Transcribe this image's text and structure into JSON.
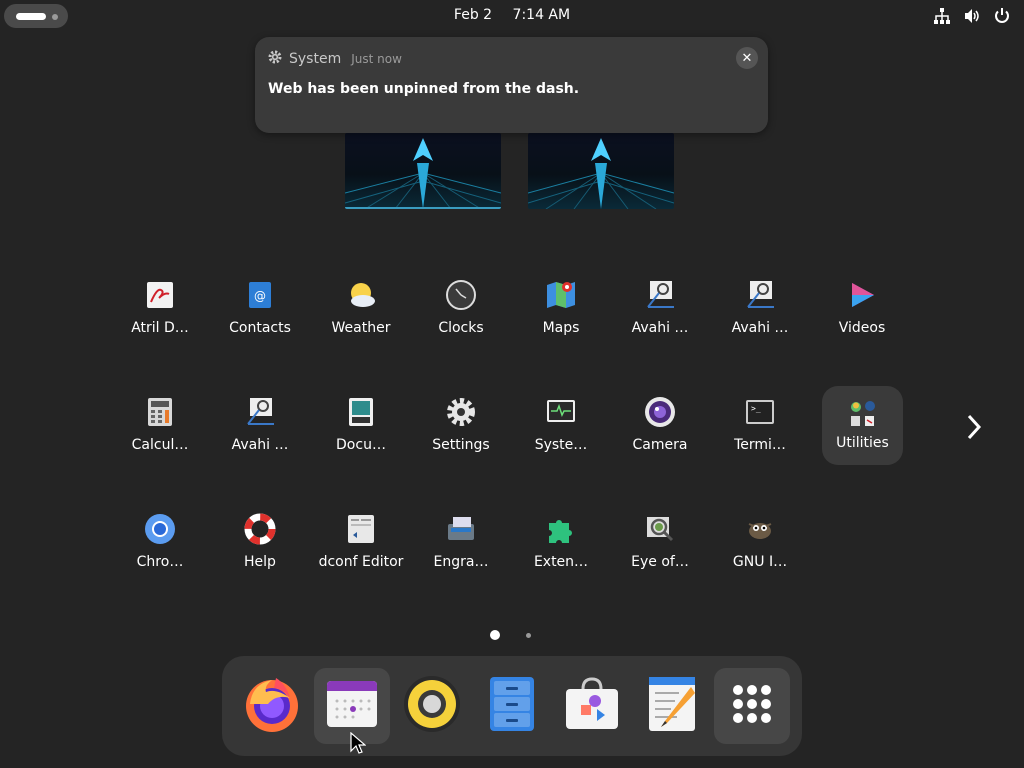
{
  "topbar": {
    "date": "Feb 2",
    "time": "7:14 AM",
    "icons": [
      "network-icon",
      "volume-icon",
      "power-icon"
    ]
  },
  "notification": {
    "source": "System",
    "time": "Just now",
    "message": "Web has been unpinned from the dash.",
    "close_icon": "close-icon"
  },
  "app_grid": {
    "rows": [
      [
        {
          "label": "Atril D…",
          "icon": "atril-icon"
        },
        {
          "label": "Contacts",
          "icon": "contacts-icon"
        },
        {
          "label": "Weather",
          "icon": "weather-icon"
        },
        {
          "label": "Clocks",
          "icon": "clocks-icon"
        },
        {
          "label": "Maps",
          "icon": "maps-icon"
        },
        {
          "label": "Avahi …",
          "icon": "avahi-icon"
        },
        {
          "label": "Avahi …",
          "icon": "avahi-icon"
        },
        {
          "label": "Videos",
          "icon": "videos-icon"
        }
      ],
      [
        {
          "label": "Calcul…",
          "icon": "calculator-icon"
        },
        {
          "label": "Avahi …",
          "icon": "avahi-icon"
        },
        {
          "label": "Docu…",
          "icon": "document-scanner-icon"
        },
        {
          "label": "Settings",
          "icon": "settings-icon"
        },
        {
          "label": "Syste…",
          "icon": "system-monitor-icon"
        },
        {
          "label": "Camera",
          "icon": "camera-icon"
        },
        {
          "label": "Termi…",
          "icon": "terminal-icon"
        },
        {
          "label": "Utilities",
          "icon": "utilities-folder-icon"
        }
      ],
      [
        {
          "label": "Chro…",
          "icon": "chromium-icon"
        },
        {
          "label": "Help",
          "icon": "help-icon"
        },
        {
          "label": "dconf Editor",
          "icon": "dconf-editor-icon"
        },
        {
          "label": "Engra…",
          "icon": "engrampa-icon"
        },
        {
          "label": "Exten…",
          "icon": "extensions-icon"
        },
        {
          "label": "Eye of…",
          "icon": "eye-of-gnome-icon"
        },
        {
          "label": "GNU I…",
          "icon": "gimp-icon"
        }
      ]
    ],
    "next_page_icon": "chevron-right-icon",
    "pages": 2,
    "current_page": 1
  },
  "dash": {
    "items": [
      {
        "name": "firefox",
        "icon": "firefox-icon"
      },
      {
        "name": "calendar",
        "icon": "calendar-icon"
      },
      {
        "name": "rhythmbox",
        "icon": "rhythmbox-icon"
      },
      {
        "name": "files",
        "icon": "files-icon"
      },
      {
        "name": "software",
        "icon": "software-icon"
      },
      {
        "name": "text-editor",
        "icon": "text-editor-icon"
      },
      {
        "name": "show-apps",
        "icon": "show-apps-grid-icon"
      }
    ]
  }
}
